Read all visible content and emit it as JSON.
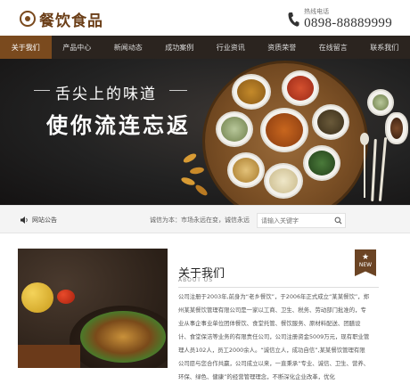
{
  "header": {
    "logo_text": "餐饮食品",
    "phone_label": "热线电话",
    "phone_number": "0898-88889999"
  },
  "nav": {
    "items": [
      {
        "label": "关于我们",
        "active": true
      },
      {
        "label": "产品中心",
        "active": false
      },
      {
        "label": "新闻动态",
        "active": false
      },
      {
        "label": "成功案例",
        "active": false
      },
      {
        "label": "行业资讯",
        "active": false
      },
      {
        "label": "资质荣誉",
        "active": false
      },
      {
        "label": "在线留言",
        "active": false
      },
      {
        "label": "联系我们",
        "active": false
      }
    ]
  },
  "banner": {
    "slogan_line1": "舌尖上的味道",
    "slogan_line2": "使你流连忘返"
  },
  "notice": {
    "label": "网站公告",
    "text": "诚信为本：市场永远在变，诚信永远",
    "search_placeholder": "请输入关键字"
  },
  "about": {
    "title": "关于我们",
    "subtitle": "ABOUT US",
    "badge": "NEW",
    "body": "公司注册于2003年,前身为“老乡餐饮”，于2006年正式成立“某某餐饮”，郑州某某餐饮管理有限公司是一家以工商、卫生、税务、劳动部门批准的，专业从事企事业单位团体餐饮、食堂托管、餐饮服务、原材料配送、团膳设计、食堂保洁等业务的有限责任公司，公司注册资金5009万元，现有职业管理人员102人，员工2000余人。“诚信立人，成功自信”,某某餐饮管理有限公司愿与您合作共赢，公司成立以来，一直秉承“专业、诚信、卫生、营养、环保、绿色、健康”的经营管理理念，不断深化企业改革，优化"
  },
  "colors": {
    "brand_brown": "#7a4a1e",
    "nav_bg": "#2b241f"
  }
}
